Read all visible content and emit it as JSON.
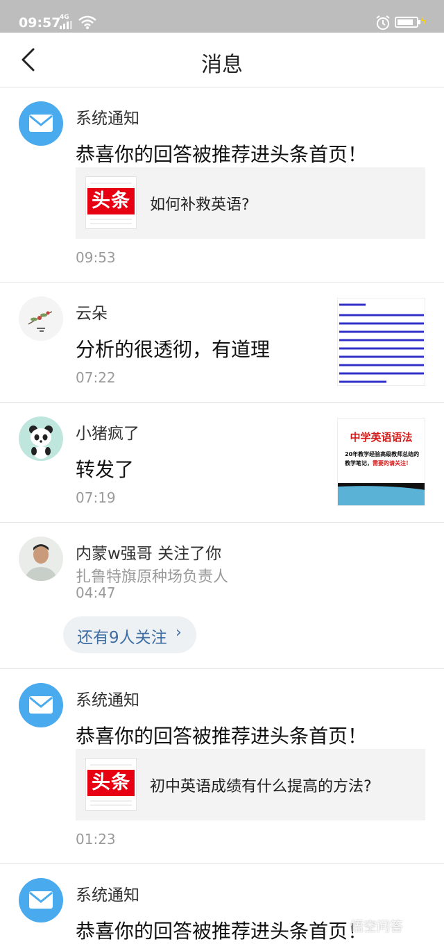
{
  "status_bar": {
    "time": "09:57",
    "network": "4G"
  },
  "header": {
    "title": "消息"
  },
  "items": [
    {
      "name": "系统通知",
      "message": "恭喜你的回答被推荐进头条首页！",
      "card_logo": "头条",
      "card_text": "如何补救英语?",
      "time": "09:53"
    },
    {
      "name": "云朵",
      "message": "分析的很透彻，有道理",
      "time": "07:22"
    },
    {
      "name": "小猪疯了",
      "message": "转发了",
      "time": "07:19",
      "thumb_title": "中学英语语法",
      "thumb_text": "20年教学经验高级教师总结的教学笔记，",
      "thumb_text_red": "需要的请关注！"
    },
    {
      "name": "内蒙w强哥",
      "action": "关注了你",
      "subtitle": "扎鲁特旗原种场负责人",
      "time": "04:47",
      "more_label": "还有9人关注",
      "more_chevron": "›"
    },
    {
      "name": "系统通知",
      "message": "恭喜你的回答被推荐进头条首页！",
      "card_logo": "头条",
      "card_text": "初中英语成绩有什么提高的方法?",
      "time": "01:23"
    },
    {
      "name": "系统通知",
      "message": "恭喜你的回答被推荐进头条首页！"
    }
  ],
  "watermark": "悟空问答",
  "colors": {
    "system_avatar": "#4aaaee",
    "logo_red": "#e60012",
    "link_blue": "#3f6ea4",
    "statusbar": "#bdbdbd"
  },
  "icons": [
    "back-arrow-icon",
    "mail-icon",
    "signal-icon",
    "wifi-icon",
    "alarm-icon",
    "battery-icon",
    "chevron-right-icon"
  ]
}
